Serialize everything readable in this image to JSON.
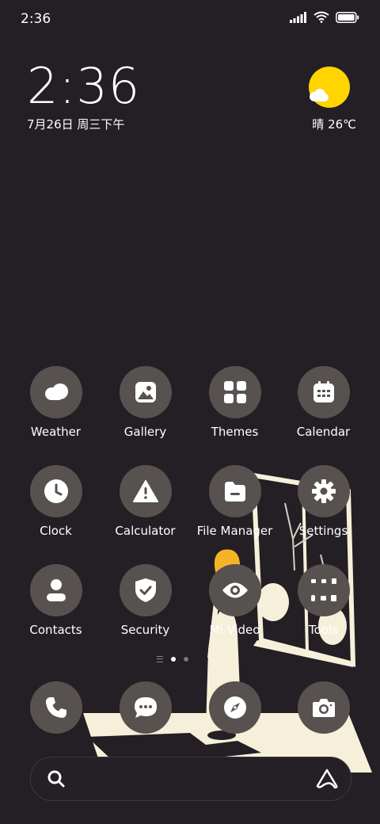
{
  "status": {
    "time": "2:36"
  },
  "clock": {
    "time": "2:36",
    "date": "7月26日 周三下午"
  },
  "weather": {
    "text": "晴 26℃",
    "icon": "sun-cloud-icon",
    "sun_color": "#ffd400"
  },
  "apps": [
    {
      "label": "Weather",
      "icon": "cloud-icon"
    },
    {
      "label": "Gallery",
      "icon": "image-icon"
    },
    {
      "label": "Themes",
      "icon": "grid-icon"
    },
    {
      "label": "Calendar",
      "icon": "calendar-icon"
    },
    {
      "label": "Clock",
      "icon": "clock-icon"
    },
    {
      "label": "Calculator",
      "icon": "warning-icon"
    },
    {
      "label": "File Manager",
      "icon": "folder-icon"
    },
    {
      "label": "Settings",
      "icon": "gear-icon"
    },
    {
      "label": "Contacts",
      "icon": "person-icon"
    },
    {
      "label": "Security",
      "icon": "shield-icon"
    },
    {
      "label": "Mi Video",
      "icon": "eye-icon"
    },
    {
      "label": "Tools",
      "icon": "tools-folder-icon"
    }
  ],
  "dock": [
    {
      "name": "phone",
      "icon": "phone-icon"
    },
    {
      "name": "messages",
      "icon": "chat-icon"
    },
    {
      "name": "browser",
      "icon": "compass-icon"
    },
    {
      "name": "camera",
      "icon": "camera-icon"
    }
  ],
  "colors": {
    "background": "#231f24",
    "icon_bg": "#57524f",
    "accent_yellow": "#ffd400",
    "scene_cream": "#f6f0da"
  }
}
